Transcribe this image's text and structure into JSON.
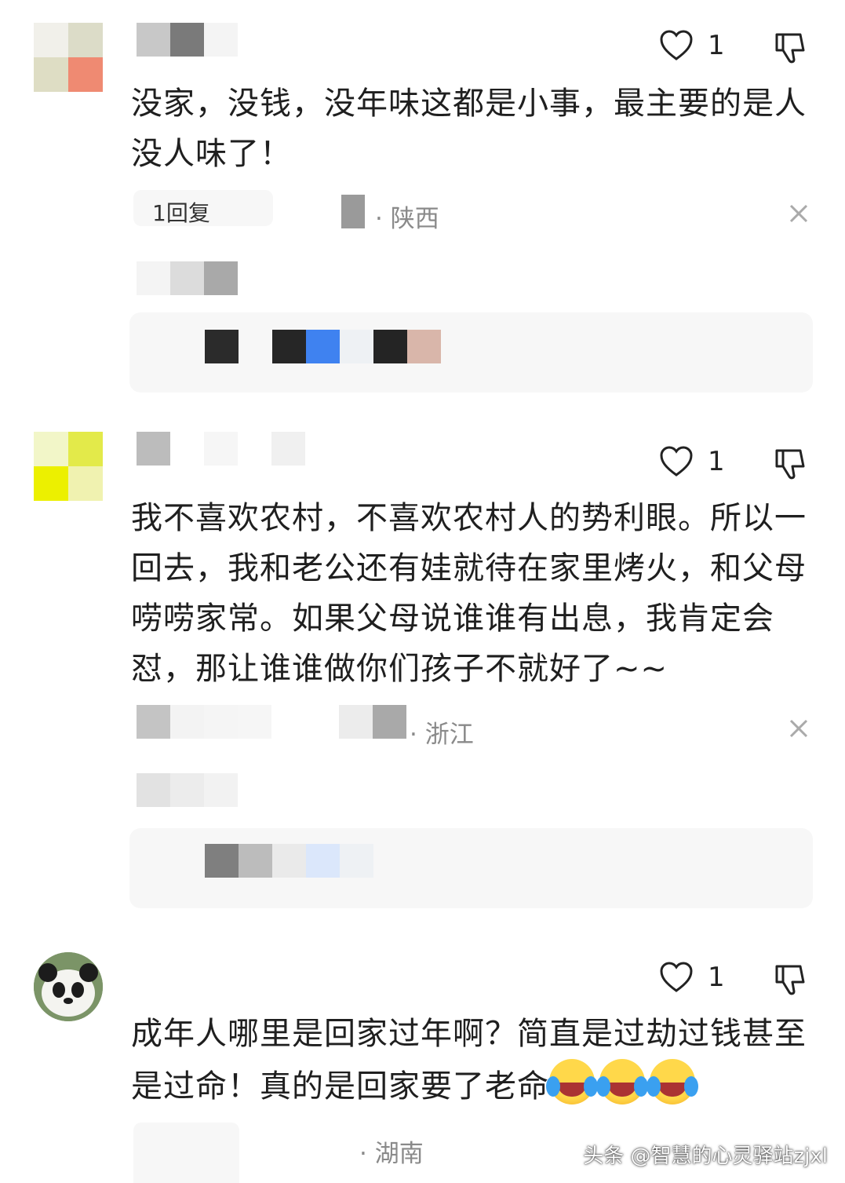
{
  "comments": [
    {
      "like_count": "1",
      "text": "没家，没钱，没年味这都是小事，最主要的是人没人味了！",
      "meta_time": "1回复",
      "location": "· 陕西"
    },
    {
      "like_count": "1",
      "text": "我不喜欢农村，不喜欢农村人的势利眼。所以一回去，我和老公还有娃就待在家里烤火，和父母唠唠家常。如果父母说谁谁有出息，我肯定会怼，那让谁谁做你们孩子不就好了~~",
      "location": "· 浙江"
    },
    {
      "like_count": "1",
      "text": "成年人哪里是回家过年啊？简直是过劫过钱甚至是过命！真的是回家要了老命",
      "emojis": [
        "laughing-crying-emoji",
        "laughing-crying-emoji",
        "laughing-crying-emoji"
      ],
      "location": "· 湖南"
    }
  ],
  "watermark": "头条 @智慧的心灵驿站zjxl",
  "colors": {
    "text": "#1f1f1f",
    "meta": "#8a8a8a",
    "reply_bg": "#f7f7f7"
  }
}
